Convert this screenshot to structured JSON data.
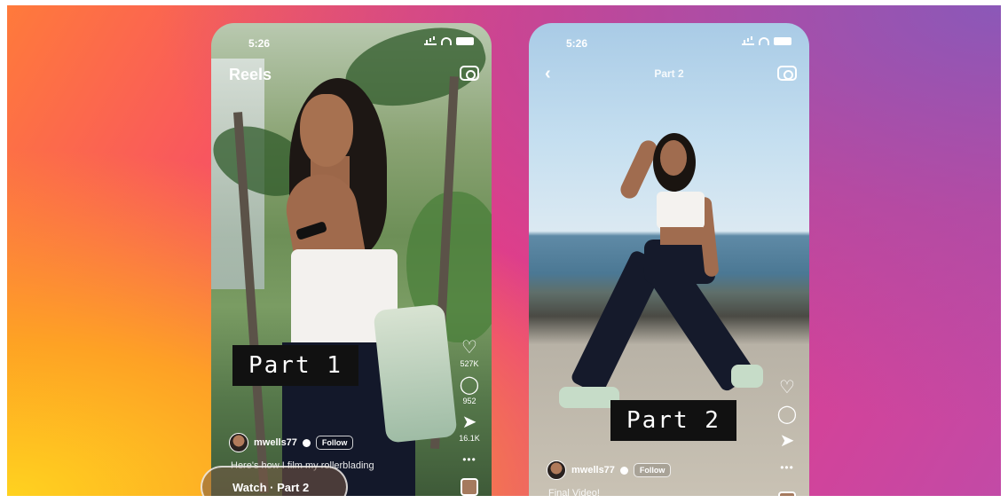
{
  "phone1": {
    "time": "5:26",
    "title": "Reels",
    "part_label": "Part 1",
    "like_count": "527K",
    "comment_count": "952",
    "share_count": "16.1K",
    "username": "mwells77",
    "follow_label": "Follow",
    "caption": "Here's how I film my rollerblading",
    "watch_label": "Watch · Part 2"
  },
  "phone2": {
    "time": "5:26",
    "title": "Part 2",
    "part_label": "Part 2",
    "username": "mwells77",
    "follow_label": "Follow",
    "caption": "Final Video!"
  },
  "icons": {
    "heart": "♡",
    "comment": "◯",
    "share": "➤",
    "more": "•••",
    "back": "‹"
  },
  "colors": {
    "banner_yellow": "#ffd21f",
    "banner_pink": "#f33a7b",
    "banner_purple": "#8b58b8",
    "label_bg": "#111111"
  }
}
